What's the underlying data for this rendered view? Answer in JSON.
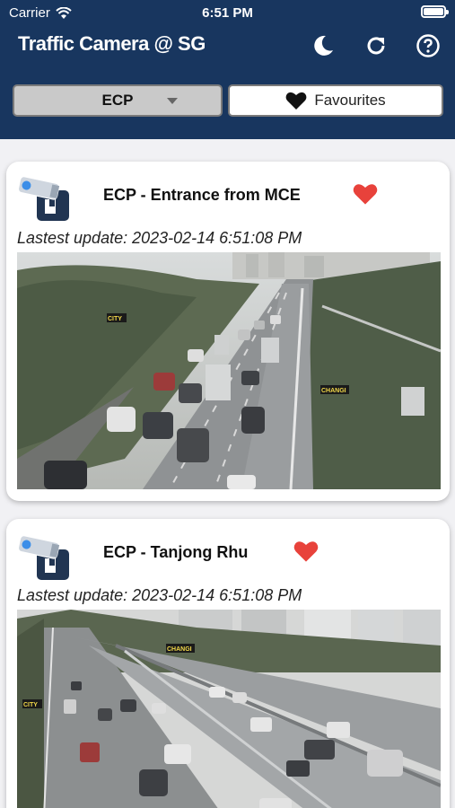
{
  "status_bar": {
    "carrier": "Carrier",
    "time": "6:51 PM"
  },
  "header": {
    "title": "Traffic Camera @ SG",
    "icons": [
      "moon-icon",
      "refresh-icon",
      "help-icon"
    ]
  },
  "filters": {
    "route_selected": "ECP",
    "favourites_label": "Favourites"
  },
  "cameras": [
    {
      "name": "ECP - Entrance from MCE",
      "update": "Lastest update: 2023-02-14 6:51:08 PM",
      "favourite": true,
      "overlay_labels": [
        "CITY",
        "CHANGI"
      ]
    },
    {
      "name": "ECP - Tanjong Rhu",
      "update": "Lastest update: 2023-02-14 6:51:08 PM",
      "favourite": true,
      "overlay_labels": [
        "CHANGI",
        "CITY"
      ]
    }
  ],
  "colors": {
    "header_bg": "#18365f",
    "heart": "#e8423b",
    "page_bg": "#f1f1f4"
  }
}
